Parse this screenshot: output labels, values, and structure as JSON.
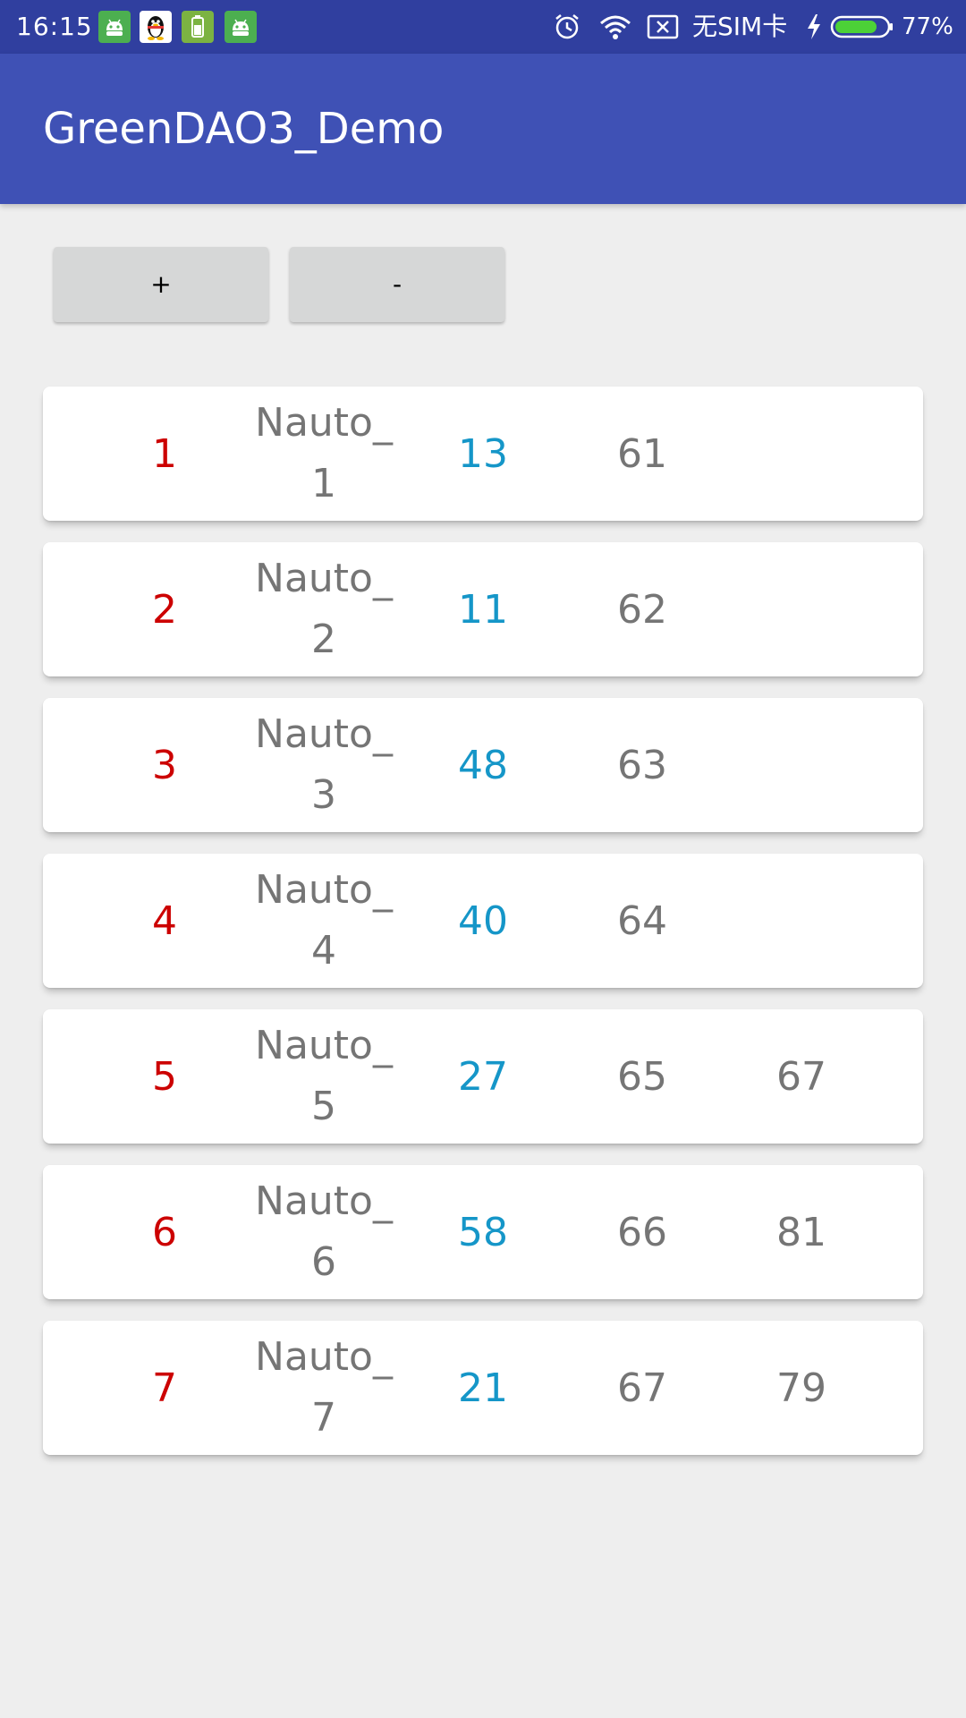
{
  "status_bar": {
    "time": "16:15",
    "sim_status": "无SIM卡",
    "battery_percent": "77%",
    "battery_level": 0.77,
    "notification_icons": [
      "android-icon",
      "qq-penguin-icon",
      "battery-app-icon",
      "android-icon"
    ],
    "system_icons": [
      "alarm-icon",
      "wifi-icon",
      "no-sim-icon",
      "charging-icon",
      "battery-icon"
    ]
  },
  "app_bar": {
    "title": "GreenDAO3_Demo"
  },
  "toolbar": {
    "add_label": "+",
    "remove_label": "-"
  },
  "rows": [
    {
      "id": "1",
      "name_line1": "Nauto_",
      "name_line2": "1",
      "a": "13",
      "b": "61",
      "c": ""
    },
    {
      "id": "2",
      "name_line1": "Nauto_",
      "name_line2": "2",
      "a": "11",
      "b": "62",
      "c": ""
    },
    {
      "id": "3",
      "name_line1": "Nauto_",
      "name_line2": "3",
      "a": "48",
      "b": "63",
      "c": ""
    },
    {
      "id": "4",
      "name_line1": "Nauto_",
      "name_line2": "4",
      "a": "40",
      "b": "64",
      "c": ""
    },
    {
      "id": "5",
      "name_line1": "Nauto_",
      "name_line2": "5",
      "a": "27",
      "b": "65",
      "c": "67"
    },
    {
      "id": "6",
      "name_line1": "Nauto_",
      "name_line2": "6",
      "a": "58",
      "b": "66",
      "c": "81"
    },
    {
      "id": "7",
      "name_line1": "Nauto_",
      "name_line2": "7",
      "a": "21",
      "b": "67",
      "c": "79"
    }
  ],
  "colors": {
    "status_bar": "#303f9f",
    "app_bar": "#3f51b5",
    "background": "#eeeeee",
    "id_text": "#cc0000",
    "accent_text": "#1596c8",
    "secondary_text": "#757575",
    "button": "#d6d7d7"
  }
}
